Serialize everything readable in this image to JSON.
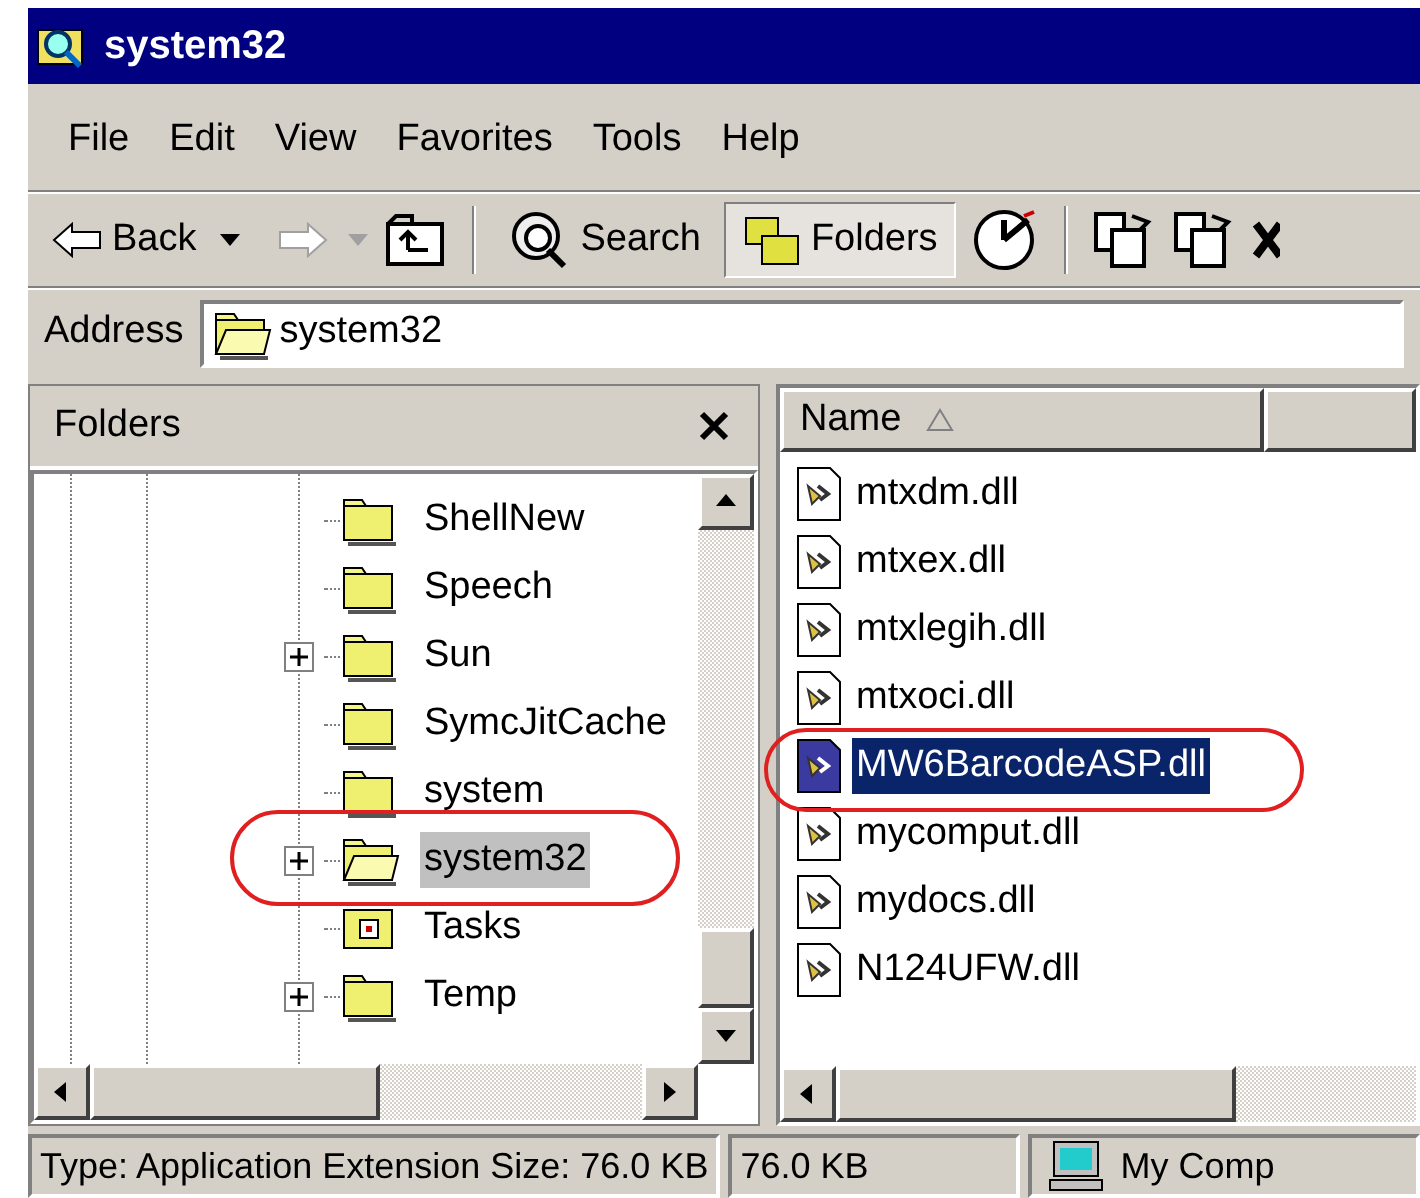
{
  "window": {
    "title": "system32"
  },
  "menu": [
    "File",
    "Edit",
    "View",
    "Favorites",
    "Tools",
    "Help"
  ],
  "toolbar": {
    "back": "Back",
    "search": "Search",
    "folders": {
      "label": "Folders",
      "selected": true
    }
  },
  "address": {
    "label": "Address",
    "value": "system32"
  },
  "folders_pane": {
    "title": "Folders",
    "items": [
      {
        "name": "ShellNew",
        "expandable": false,
        "selected": false,
        "kind": "folder"
      },
      {
        "name": "Speech",
        "expandable": false,
        "selected": false,
        "kind": "folder"
      },
      {
        "name": "Sun",
        "expandable": true,
        "selected": false,
        "kind": "folder"
      },
      {
        "name": "SymcJitCache",
        "expandable": false,
        "selected": false,
        "kind": "folder"
      },
      {
        "name": "system",
        "expandable": false,
        "selected": false,
        "kind": "folder"
      },
      {
        "name": "system32",
        "expandable": true,
        "selected": true,
        "kind": "folder"
      },
      {
        "name": "Tasks",
        "expandable": false,
        "selected": false,
        "kind": "tasks"
      },
      {
        "name": "Temp",
        "expandable": true,
        "selected": false,
        "kind": "folder"
      }
    ]
  },
  "files": {
    "columns": [
      "Name"
    ],
    "items": [
      {
        "name": "mtxdm.dll",
        "selected": false
      },
      {
        "name": "mtxex.dll",
        "selected": false
      },
      {
        "name": "mtxlegih.dll",
        "selected": false
      },
      {
        "name": "mtxoci.dll",
        "selected": false
      },
      {
        "name": "MW6BarcodeASP.dll",
        "selected": true
      },
      {
        "name": "mycomput.dll",
        "selected": false
      },
      {
        "name": "mydocs.dll",
        "selected": false
      },
      {
        "name": "N124UFW.dll",
        "selected": false
      }
    ]
  },
  "status_bar": [
    "Type: Application Extension Size: 76.0 KB",
    "76.0 KB",
    "My Comp"
  ]
}
